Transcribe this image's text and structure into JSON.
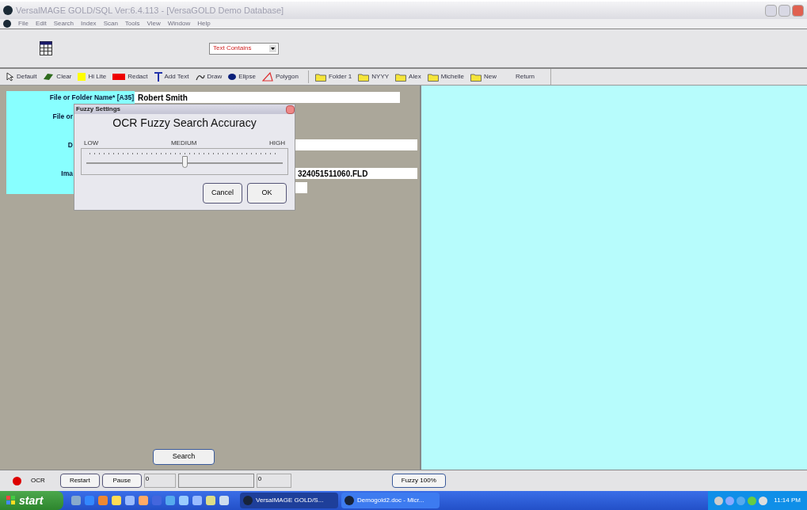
{
  "window": {
    "title": "VersalMAGE GOLD/SQL Ver:6.4.113 - [VersaGOLD Demo Database]"
  },
  "menu": [
    "File",
    "Edit",
    "Search",
    "Index",
    "Scan",
    "Tools",
    "View",
    "Window",
    "Help"
  ],
  "search_mode": {
    "value": "Text Contains"
  },
  "tools": [
    {
      "kind": "pointer",
      "label": "Default"
    },
    {
      "kind": "eraser",
      "label": "Clear"
    },
    {
      "kind": "highlight",
      "label": "Hi Lite"
    },
    {
      "kind": "redact",
      "label": "Redact"
    },
    {
      "kind": "text",
      "label": "Add Text"
    },
    {
      "kind": "draw",
      "label": "Draw"
    },
    {
      "kind": "ellipse",
      "label": "Elipse"
    },
    {
      "kind": "polygon",
      "label": "Polygon"
    }
  ],
  "folders": [
    "Folder 1",
    "NYYY",
    "Alex",
    "Michelle",
    "New"
  ],
  "return_button": "Return",
  "form": {
    "fields": [
      {
        "kind": "field",
        "label": "File or Folder Name* [A35]",
        "value": "Robert Smith"
      },
      {
        "kind": "label",
        "label": "File or"
      },
      {
        "kind": "field",
        "label": "D"
      },
      {
        "kind": "field",
        "label": "Ima",
        "value": "324051511060.FLD"
      }
    ]
  },
  "search_button": "Search",
  "dialog": {
    "title": "Fuzzy Settings",
    "heading": "OCR Fuzzy Search Accuracy",
    "scale": [
      "LOW",
      "MEDIUM",
      "HIGH"
    ],
    "level": 0.5,
    "buttons": [
      "Cancel",
      "OK"
    ]
  },
  "status_bar": {
    "label": "OCR",
    "buttons": [
      "Restart",
      "Pause"
    ],
    "counter_1": "0",
    "counter_2": "0",
    "fuzzy_button": "Fuzzy 100%"
  },
  "taskbar": {
    "start": "start",
    "tasks": [
      {
        "label": "VersaIMAGE GOLD/S...",
        "selected": true
      },
      {
        "label": "Demogold2.doc - Micr...",
        "selected": false
      }
    ],
    "clock": "11:14 PM"
  }
}
